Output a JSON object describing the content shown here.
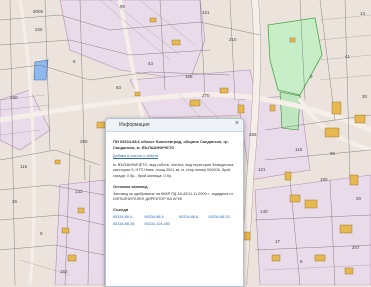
{
  "map": {
    "parcel_labels": [
      "9005",
      "225",
      "90",
      "221",
      "8",
      "43",
      "210",
      "63",
      "250",
      "270",
      "282",
      "265",
      "14",
      "41",
      "30",
      "116",
      "55",
      "180",
      "20",
      "140",
      "17",
      "6",
      "207",
      "115",
      "26",
      "9",
      "132",
      "162",
      "250",
      "165",
      "9",
      "121"
    ]
  },
  "popup": {
    "title": "Информация",
    "close_icon": "close-icon",
    "parcel_heading": "ПИ 65334.88.6 област Благоевград, община Санданскн, гр. Сандански, м. ВЪЛШИНИЧЕТО",
    "add_link": "Добави в списък с обекти",
    "description": "м. ВЪЛШИНИЧЕТО, вид собств. Частна, вид територия Земеделска, категория 5, НТП Нива, площ 2001 кв. м, стар номер 000006, брой сгради: 0 бр., брой жилища: 0 бр.",
    "order_title": "Основна заповед",
    "order_text": "Заповед за одобряване на КККР РД-18-40/11.11.2009 г., издадена от ИЗПЪЛНИТЕЛЕН ДИРЕКТОР НА АГКК",
    "neighbors_title": "Съседи",
    "neighbors": [
      "65334.88.4,",
      "65334.88.5,",
      "65334.88.8,",
      "65334.88.20,",
      "65334.88.28,",
      "65334.104.480"
    ]
  }
}
